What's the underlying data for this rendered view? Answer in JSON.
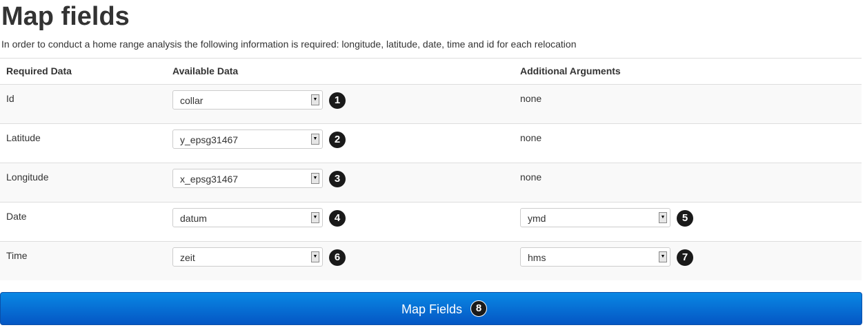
{
  "page": {
    "title": "Map fields",
    "intro": "In order to conduct a home range analysis the following information is required: longitude, latitude, date, time and id for each relocation"
  },
  "table": {
    "headers": {
      "required": "Required Data",
      "available": "Available Data",
      "additional": "Additional Arguments"
    },
    "rows": [
      {
        "required": "Id",
        "available": "collar",
        "available_badge": "1",
        "additional": "none"
      },
      {
        "required": "Latitude",
        "available": "y_epsg31467",
        "available_badge": "2",
        "additional": "none"
      },
      {
        "required": "Longitude",
        "available": "x_epsg31467",
        "available_badge": "3",
        "additional": "none"
      },
      {
        "required": "Date",
        "available": "datum",
        "available_badge": "4",
        "additional": "ymd",
        "additional_badge": "5"
      },
      {
        "required": "Time",
        "available": "zeit",
        "available_badge": "6",
        "additional": "hms",
        "additional_badge": "7"
      }
    ]
  },
  "button": {
    "label": "Map Fields",
    "badge": "8"
  },
  "icons": {
    "dropdown": "chevron-down-icon"
  },
  "colors": {
    "button_top": "#0a88e4",
    "button_bottom": "#0456c4",
    "badge": "#1a1a1a"
  }
}
